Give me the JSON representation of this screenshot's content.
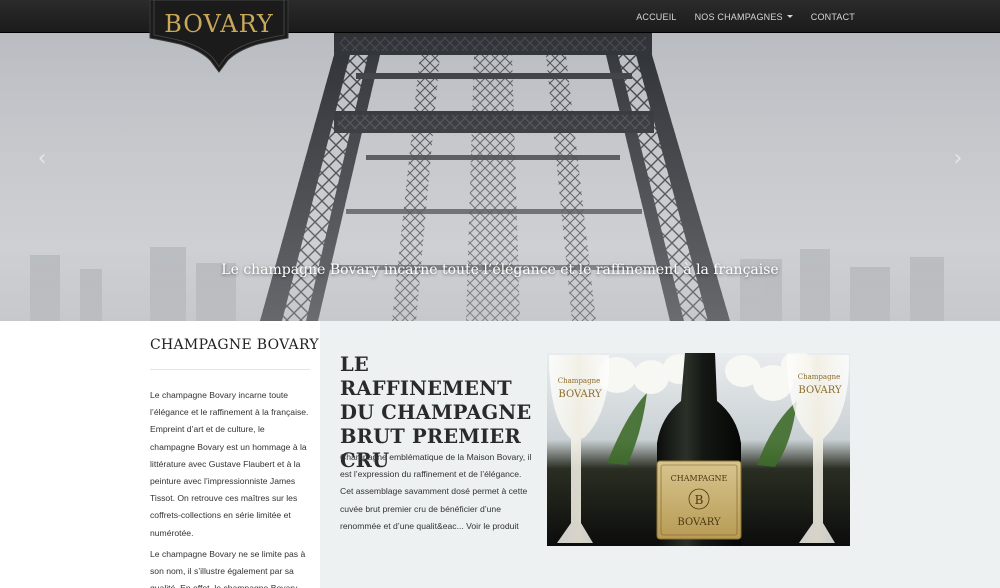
{
  "brand": {
    "logo_text": "BOVARY"
  },
  "nav": {
    "items": [
      {
        "label": "ACCUEIL"
      },
      {
        "label": "NOS CHAMPAGNES"
      },
      {
        "label": "CONTACT"
      }
    ]
  },
  "hero": {
    "caption": "Le champagne Bovary incarne toute l’élégance et le raffinement à la française",
    "prev_glyph": "‹",
    "next_glyph": "›"
  },
  "sidebar": {
    "title": "CHAMPAGNE BOVARY",
    "paragraph1": "Le champagne Bovary incarne toute l’élégance et le raffinement à la française. Empreint d’art et de culture, le champagne Bovary est un hommage à la littérature avec Gustave Flaubert et à la peinture avec l’impressionniste James Tissot. On retrouve ces maîtres sur les coffrets-collections en série limitée et numérotée.",
    "paragraph2": "Le champagne Bovary ne se limite pas à son nom, il s’illustre également par sa qualité. En effet, le champagne Bovary est"
  },
  "product": {
    "title": "LE RAFFINEMENT DU CHAMPAGNE BRUT PREMIER CRU",
    "description": "Champagne emblématique de la Maison Bovary, il est l’expression du raffinement et de l’élégance. Cet assemblage savamment dosé permet à cette cuvée brut premier cru de bénéficier d’une renommée et d’une qualit&eac... ",
    "link_label": "Voir le produit",
    "label_top": "CHAMPAGNE",
    "label_monogram": "B",
    "label_bottom": "BOVARY",
    "glass_text_top": "Champagne",
    "glass_text_bottom": "BOVARY"
  },
  "colors": {
    "gold": "#c9a85a",
    "navbar": "#1f1f1f",
    "main_bg": "#edf1f2"
  }
}
